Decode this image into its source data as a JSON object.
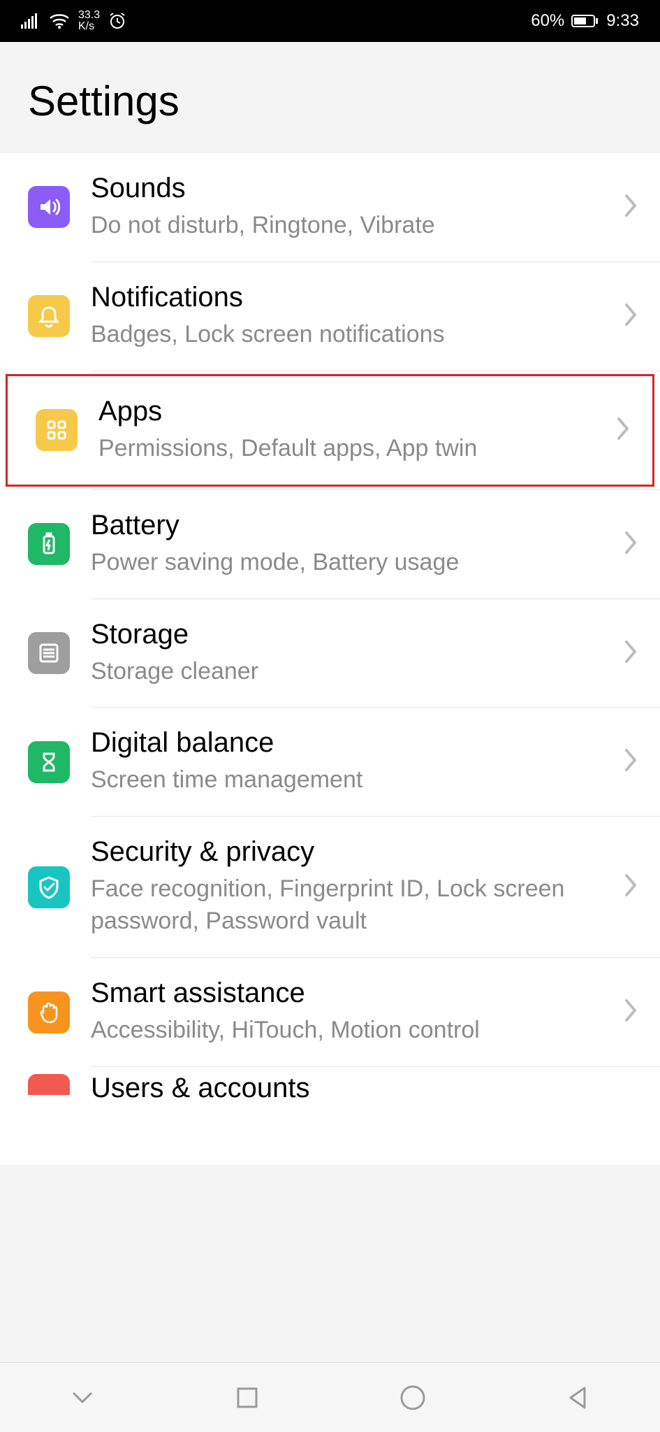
{
  "status": {
    "net_speed_top": "33.3",
    "net_speed_bottom": "K/s",
    "battery_pct": "60%",
    "time": "9:33"
  },
  "header": {
    "title": "Settings"
  },
  "rows": {
    "sounds": {
      "title": "Sounds",
      "subtitle": "Do not disturb, Ringtone, Vibrate"
    },
    "notifications": {
      "title": "Notifications",
      "subtitle": "Badges, Lock screen notifications"
    },
    "apps": {
      "title": "Apps",
      "subtitle": "Permissions, Default apps, App twin"
    },
    "battery": {
      "title": "Battery",
      "subtitle": "Power saving mode, Battery usage"
    },
    "storage": {
      "title": "Storage",
      "subtitle": "Storage cleaner"
    },
    "digital": {
      "title": "Digital balance",
      "subtitle": "Screen time management"
    },
    "security": {
      "title": "Security & privacy",
      "subtitle": "Face recognition, Fingerprint ID, Lock screen password, Password vault"
    },
    "smart": {
      "title": "Smart assistance",
      "subtitle": "Accessibility, HiTouch, Motion control"
    },
    "users": {
      "title": "Users & accounts",
      "subtitle": ""
    }
  }
}
